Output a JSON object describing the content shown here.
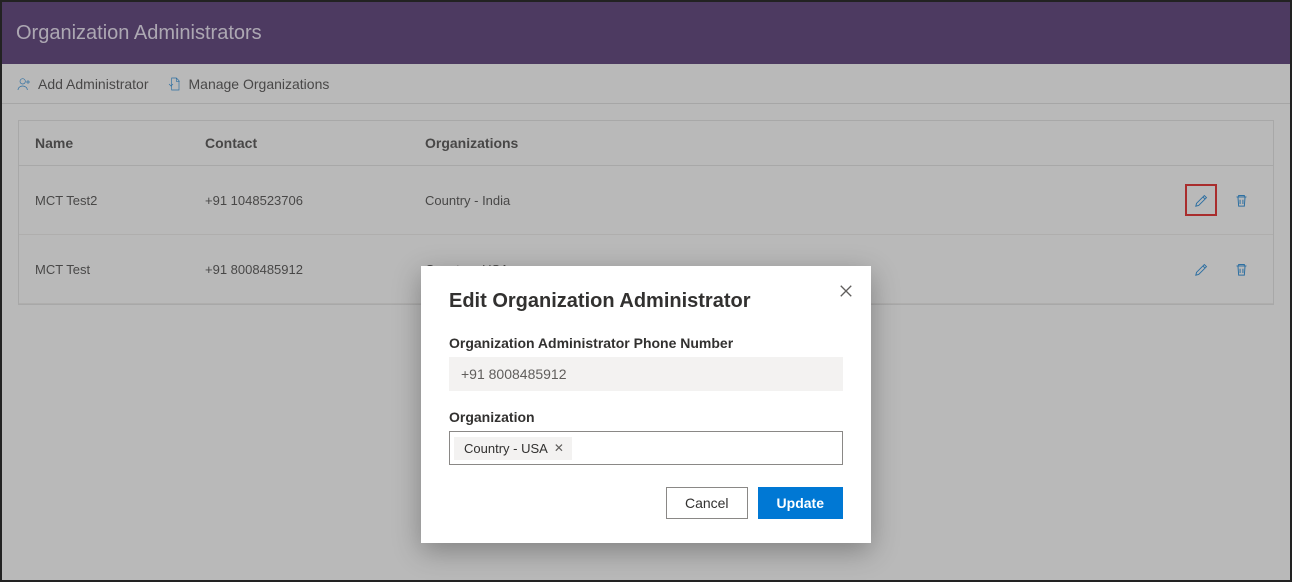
{
  "header": {
    "title": "Organization Administrators"
  },
  "toolbar": {
    "add_label": "Add Administrator",
    "manage_label": "Manage Organizations"
  },
  "table": {
    "headers": {
      "name": "Name",
      "contact": "Contact",
      "organizations": "Organizations"
    },
    "rows": [
      {
        "name": "MCT Test2",
        "contact": "+91 1048523706",
        "organizations": "Country - India",
        "edit_highlight": true
      },
      {
        "name": "MCT Test",
        "contact": "+91 8008485912",
        "organizations": "Country - USA",
        "edit_highlight": false
      }
    ]
  },
  "modal": {
    "title": "Edit Organization Administrator",
    "phone_label": "Organization Administrator Phone Number",
    "phone_value": "+91 8008485912",
    "org_label": "Organization",
    "org_selected": "Country - USA",
    "cancel_label": "Cancel",
    "update_label": "Update"
  }
}
